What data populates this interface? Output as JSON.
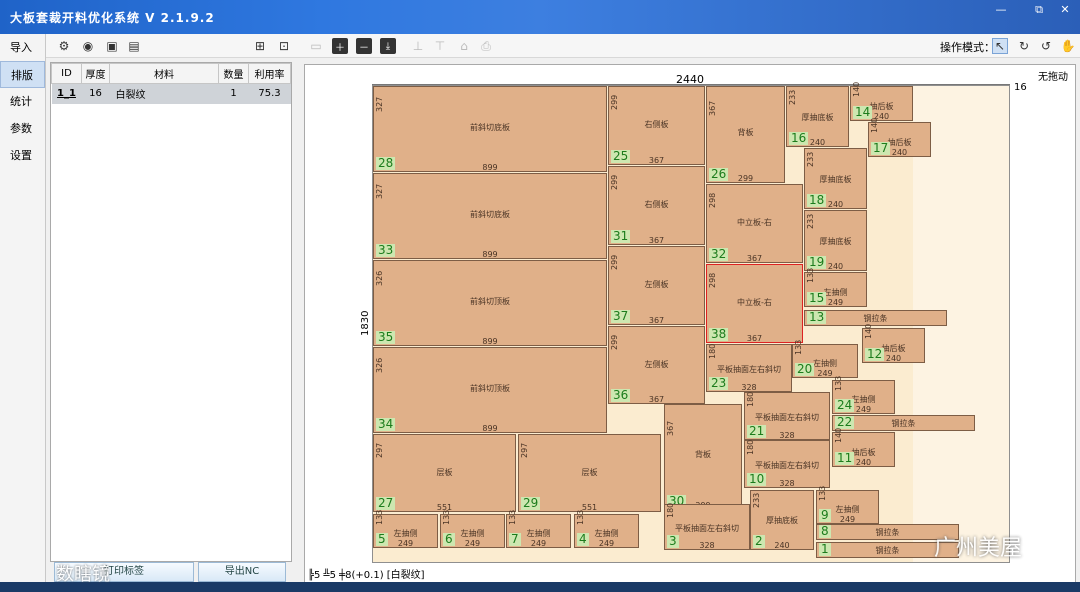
{
  "window": {
    "title": "大板套裁开料优化系统  V 2.1.9.2",
    "minimize": "—",
    "restore": "⧉",
    "close": "✕"
  },
  "sidebar": {
    "items": [
      {
        "label": "导入"
      },
      {
        "label": "排版"
      },
      {
        "label": "统计"
      },
      {
        "label": "参数"
      },
      {
        "label": "设置"
      }
    ]
  },
  "toolbar": {
    "op_mode_label": "操作模式："
  },
  "table": {
    "headers": [
      "ID",
      "厚度",
      "材料",
      "数量",
      "利用率"
    ],
    "rows": [
      {
        "id": "1_1",
        "thickness": "16",
        "material": "白裂纹",
        "qty": "1",
        "rate": "75.3"
      }
    ]
  },
  "left_buttons": {
    "print_labels": "打印标签",
    "export_nc": "导出NC"
  },
  "canvas": {
    "no_drag": "无拖动",
    "width_label": "2440",
    "height_label": "1830",
    "thickness_label": "16"
  },
  "status": {
    "text": "╠5 ╩5  ╪8(+0.1)   [白裂纹]"
  },
  "watermarks": {
    "left": "数瞎镜",
    "right": "广州美屋"
  },
  "pieces": [
    {
      "n": "28",
      "name": "前斜切底板",
      "w": "899",
      "h": "327"
    },
    {
      "n": "33",
      "name": "前斜切底板",
      "w": "899",
      "h": "327"
    },
    {
      "n": "35",
      "name": "前斜切顶板",
      "w": "899",
      "h": "326"
    },
    {
      "n": "34",
      "name": "前斜切顶板",
      "w": "899",
      "h": "326"
    },
    {
      "n": "25",
      "name": "右侧板",
      "w": "367",
      "h": "299"
    },
    {
      "n": "31",
      "name": "右侧板",
      "w": "367",
      "h": "299"
    },
    {
      "n": "37",
      "name": "左侧板",
      "w": "367",
      "h": "299"
    },
    {
      "n": "36",
      "name": "左侧板",
      "w": "367",
      "h": "299"
    },
    {
      "n": "26",
      "name": "背板",
      "w": "299",
      "h": "367"
    },
    {
      "n": "32",
      "name": "中立板-右",
      "w": "367",
      "h": "298"
    },
    {
      "n": "38",
      "name": "中立板-右",
      "w": "367",
      "h": "298"
    },
    {
      "n": "16",
      "name": "厚抽底板",
      "w": "240",
      "h": "233"
    },
    {
      "n": "14",
      "name": "抽后板",
      "w": "240",
      "h": "140"
    },
    {
      "n": "17",
      "name": "抽后板",
      "w": "240",
      "h": "140"
    },
    {
      "n": "18",
      "name": "厚抽底板",
      "w": "240",
      "h": "233"
    },
    {
      "n": "19",
      "name": "厚抽底板",
      "w": "240",
      "h": "233"
    },
    {
      "n": "15",
      "name": "左抽侧",
      "w": "249",
      "h": "133"
    },
    {
      "n": "13",
      "name": "钢拉条",
      "w": "551",
      "h": "60"
    },
    {
      "n": "12",
      "name": "抽后板",
      "w": "240",
      "h": "140"
    },
    {
      "n": "20",
      "name": "左抽侧",
      "w": "249",
      "h": "133"
    },
    {
      "n": "23",
      "name": "平板抽面左右斜切",
      "w": "328",
      "h": "180"
    },
    {
      "n": "24",
      "name": "左抽侧",
      "w": "249",
      "h": "133"
    },
    {
      "n": "22",
      "name": "钢拉条",
      "w": "551",
      "h": "60"
    },
    {
      "n": "21",
      "name": "平板抽面左右斜切",
      "w": "328",
      "h": "180"
    },
    {
      "n": "11",
      "name": "抽后板",
      "w": "240",
      "h": "140"
    },
    {
      "n": "10",
      "name": "平板抽面左右斜切",
      "w": "328",
      "h": "180"
    },
    {
      "n": "27",
      "name": "层板",
      "w": "551",
      "h": "297"
    },
    {
      "n": "29",
      "name": "层板",
      "w": "551",
      "h": "297"
    },
    {
      "n": "30",
      "name": "背板",
      "w": "299",
      "h": "367"
    },
    {
      "n": "9",
      "name": "左抽侧",
      "w": "249",
      "h": "133"
    },
    {
      "n": "8",
      "name": "钢拉条",
      "w": "551",
      "h": "60"
    },
    {
      "n": "1",
      "name": "钢拉条",
      "w": "551",
      "h": "60"
    },
    {
      "n": "5",
      "name": "左抽侧",
      "w": "249",
      "h": "133"
    },
    {
      "n": "6",
      "name": "左抽侧",
      "w": "249",
      "h": "133"
    },
    {
      "n": "7",
      "name": "左抽侧",
      "w": "249",
      "h": "133"
    },
    {
      "n": "4",
      "name": "左抽侧",
      "w": "249",
      "h": "133"
    },
    {
      "n": "3",
      "name": "平板抽面左右斜切",
      "w": "328",
      "h": "180"
    },
    {
      "n": "2",
      "name": "厚抽底板",
      "w": "240",
      "h": "233"
    }
  ]
}
